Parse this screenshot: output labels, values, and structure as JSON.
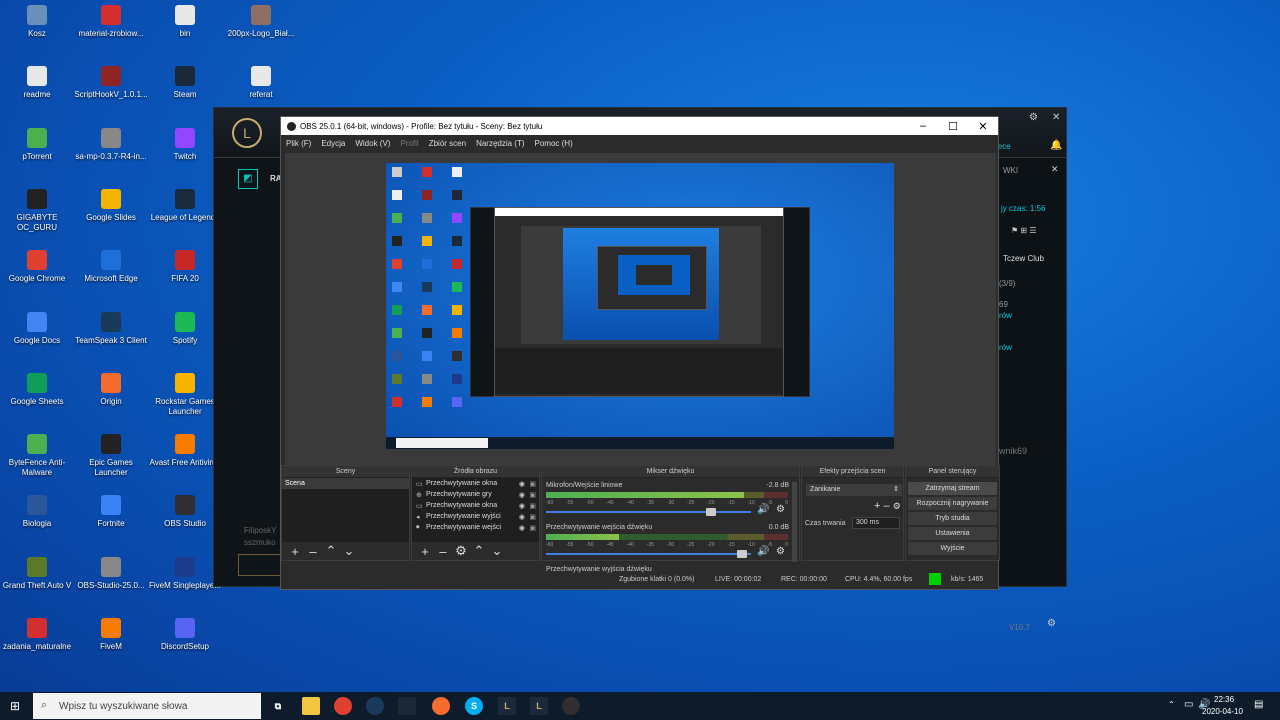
{
  "desktop_icons": [
    {
      "label": "Kosz",
      "icon": "recycle-bin-icon",
      "color": "#6a8fb8"
    },
    {
      "label": "readme",
      "icon": "text-file-icon",
      "color": "#e8e8e8"
    },
    {
      "label": "pTorrent",
      "icon": "torrent-icon",
      "color": "#4caf50"
    },
    {
      "label": "GIGABYTE OC_GURU",
      "icon": "gigabyte-icon",
      "color": "#222222"
    },
    {
      "label": "Google Chrome",
      "icon": "chrome-icon",
      "color": "#e04030"
    },
    {
      "label": "Google Docs",
      "icon": "docs-icon",
      "color": "#4285f4"
    },
    {
      "label": "Google Sheets",
      "icon": "sheets-icon",
      "color": "#0f9d58"
    },
    {
      "label": "ByteFence Anti-Malware",
      "icon": "bytefence-icon",
      "color": "#4caf50"
    },
    {
      "label": "Biologia",
      "icon": "word-icon",
      "color": "#2b579a"
    },
    {
      "label": "Grand Theft Auto V",
      "icon": "gta-icon",
      "color": "#5a7a2a"
    },
    {
      "label": "zadania_maturalne",
      "icon": "pdf-icon",
      "color": "#d32f2f"
    },
    {
      "label": "material-zrobiow...",
      "icon": "pdf-icon",
      "color": "#d32f2f"
    },
    {
      "label": "ScriptHookV_1.0.1...",
      "icon": "archive-icon",
      "color": "#8e2424"
    },
    {
      "label": "sa-mp-0.3.7-R4-in...",
      "icon": "installer-icon",
      "color": "#888888"
    },
    {
      "label": "Google Slides",
      "icon": "slides-icon",
      "color": "#f4b400"
    },
    {
      "label": "Microsoft Edge",
      "icon": "edge-icon",
      "color": "#1e6fd9"
    },
    {
      "label": "TeamSpeak 3 Client",
      "icon": "teamspeak-icon",
      "color": "#1a3a5c"
    },
    {
      "label": "Origin",
      "icon": "origin-icon",
      "color": "#f56c2d"
    },
    {
      "label": "Epic Games Launcher",
      "icon": "epic-icon",
      "color": "#222222"
    },
    {
      "label": "Fortnite",
      "icon": "fortnite-icon",
      "color": "#3b82f6"
    },
    {
      "label": "OBS-Studio-25.0...",
      "icon": "installer-icon",
      "color": "#888888"
    },
    {
      "label": "FiveM",
      "icon": "fivem-icon",
      "color": "#f57c00"
    },
    {
      "label": "bin",
      "icon": "folder-icon",
      "color": "#e8e8e8"
    },
    {
      "label": "Steam",
      "icon": "steam-icon",
      "color": "#1b2838"
    },
    {
      "label": "Twitch",
      "icon": "twitch-icon",
      "color": "#9146ff"
    },
    {
      "label": "League of Legends",
      "icon": "lol-icon",
      "color": "#1a2a3a"
    },
    {
      "label": "FIFA 20",
      "icon": "fifa-icon",
      "color": "#c62828"
    },
    {
      "label": "Spotify",
      "icon": "spotify-icon",
      "color": "#1db954"
    },
    {
      "label": "Rockstar Games Launcher",
      "icon": "rockstar-icon",
      "color": "#f4b400"
    },
    {
      "label": "Avast Free Antivirus",
      "icon": "avast-icon",
      "color": "#f57c00"
    },
    {
      "label": "OBS Studio",
      "icon": "obs-icon",
      "color": "#302e31"
    },
    {
      "label": "FiveM Singleplaye...",
      "icon": "fivem-sp-icon",
      "color": "#1e3a8a"
    },
    {
      "label": "DiscordSetup",
      "icon": "discord-icon",
      "color": "#5865f2"
    },
    {
      "label": "200px-Logo_Biał...",
      "icon": "image-icon",
      "color": "#8d6e63"
    },
    {
      "label": "referat",
      "icon": "text-file-icon",
      "color": "#e8e8e8"
    }
  ],
  "lol": {
    "r_label": "RA",
    "user_fragment": "kY",
    "link_fragment": "jece",
    "wki": "WKI",
    "queue_time": "jy czas: 1:56",
    "club": "Tczew Club",
    "count": "(3/9)",
    "n69": "69",
    "row1": "rów",
    "row2": "rów",
    "nick": "wnik69",
    "filipo": "FiliposkY",
    "version": "V10.7",
    "sszmuk": "sszmuko"
  },
  "obs": {
    "title": "OBS 25.0.1 (64-bit, windows) - Profile: Bez tytułu - Sceny: Bez tytułu",
    "menu": [
      {
        "label": "Plik (F)",
        "disabled": false
      },
      {
        "label": "Edycja",
        "disabled": false
      },
      {
        "label": "Widok (V)",
        "disabled": false
      },
      {
        "label": "Profil",
        "disabled": true
      },
      {
        "label": "Zbiór scen",
        "disabled": false
      },
      {
        "label": "Narzędzia (T)",
        "disabled": false
      },
      {
        "label": "Pomoc (H)",
        "disabled": false
      }
    ],
    "docks": {
      "scenes": "Sceny",
      "sources": "Źródła obrazu",
      "mixer": "Mikser dźwięku",
      "transitions": "Efekty przejścia scen",
      "controls": "Panel sterujący"
    },
    "scenes": [
      "Scena"
    ],
    "sources": [
      {
        "label": "Przechwytywanie okna",
        "icon": "monitor-icon"
      },
      {
        "label": "Przechwytywanie gry",
        "icon": "gamepad-icon"
      },
      {
        "label": "Przechwytywanie okna",
        "icon": "monitor-icon"
      },
      {
        "label": "Przechwytywanie wyjści",
        "icon": "speaker-icon"
      },
      {
        "label": "Przechwytywanie wejści",
        "icon": "mic-icon"
      }
    ],
    "mixer": [
      {
        "name": "Mikrofon/Wejście liniowe",
        "db": "-2.8 dB",
        "level": 0.82,
        "volume": 0.82
      },
      {
        "name": "Przechwytywanie wejścia dźwięku",
        "db": "0.0 dB",
        "level": 0.3,
        "volume": 0.98
      },
      {
        "name": "Przechwytywanie wyjścia dźwięku",
        "db": "",
        "level": 0,
        "volume": 0
      }
    ],
    "meter_ticks": [
      "-60",
      "-55",
      "-50",
      "-45",
      "-40",
      "-35",
      "-30",
      "-25",
      "-20",
      "-15",
      "-10",
      "-5",
      "0"
    ],
    "transitions": {
      "selected": "Zanikanie",
      "duration_label": "Czas trwania",
      "duration_value": "300 ms"
    },
    "controls": [
      "Zatrzymaj stream",
      "Rozpocznij nagrywanie",
      "Tryb studia",
      "Ustawienia",
      "Wyjście"
    ],
    "status": {
      "dropped": "Zgubione klatki 0 (0.0%)",
      "live": "LIVE: 00:00:02",
      "rec": "REC: 00:00:00",
      "cpu": "CPU: 4.4%, 60.00 fps",
      "kbps": "kb/s: 1465"
    }
  },
  "taskbar": {
    "search_placeholder": "Wpisz tu wyszukiwane słowa",
    "time": "22:36",
    "date": "2020-04-10"
  }
}
